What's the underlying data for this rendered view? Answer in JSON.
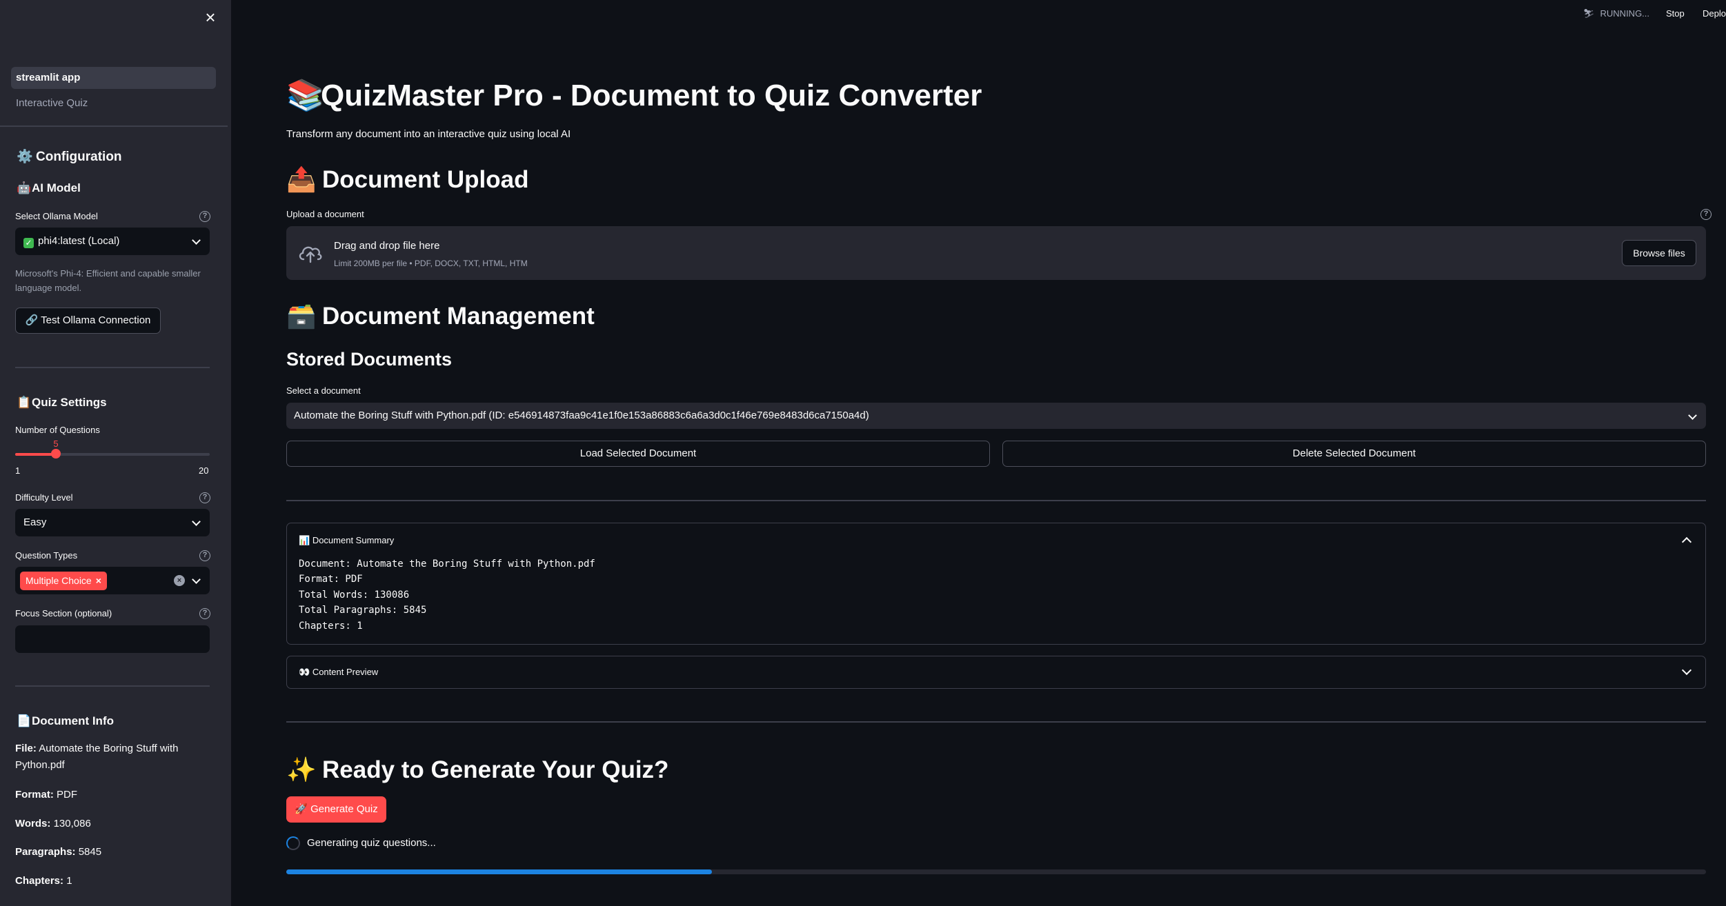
{
  "sidebar": {
    "close_icon": "×",
    "nav": [
      {
        "label": "streamlit app",
        "active": true
      },
      {
        "label": "Interactive Quiz",
        "active": false
      }
    ],
    "configuration": {
      "icon": "⚙️",
      "title": "Configuration"
    },
    "ai_model": {
      "icon": "🤖",
      "title": "AI Model",
      "select_label": "Select Ollama Model",
      "select_value": "phi4:latest (Local)",
      "caption": "Microsoft's Phi-4: Efficient and capable smaller language model.",
      "test_button": "🔗 Test Ollama Connection"
    },
    "quiz_settings": {
      "icon": "📋",
      "title": "Quiz Settings",
      "num_questions_label": "Number of Questions",
      "num_questions_value": "5",
      "num_questions_min": "1",
      "num_questions_max": "20",
      "slider_fraction": 0.2105,
      "difficulty_label": "Difficulty Level",
      "difficulty_value": "Easy",
      "question_types_label": "Question Types",
      "question_types_selected": [
        "Multiple Choice"
      ],
      "focus_label": "Focus Section (optional)",
      "focus_value": ""
    },
    "document_info": {
      "icon": "📄",
      "title": "Document Info",
      "file_label": "File:",
      "file_value": "Automate the Boring Stuff with Python.pdf",
      "format_label": "Format:",
      "format_value": "PDF",
      "words_label": "Words:",
      "words_value": "130,086",
      "paragraphs_label": "Paragraphs:",
      "paragraphs_value": "5845",
      "chapters_label": "Chapters:",
      "chapters_value": "1"
    }
  },
  "header": {
    "running": "RUNNING...",
    "stop": "Stop",
    "deploy": "Deploy"
  },
  "main": {
    "title_emoji": "📚",
    "title": "QuizMaster Pro - Document to Quiz Converter",
    "subtitle": "Transform any document into an interactive quiz using local AI",
    "upload": {
      "emoji": "📤",
      "heading": "Document Upload",
      "label": "Upload a document",
      "drag_text": "Drag and drop file here",
      "limit_text": "Limit 200MB per file • PDF, DOCX, TXT, HTML, HTM",
      "browse_button": "Browse files"
    },
    "management": {
      "emoji": "🗃️",
      "heading": "Document Management",
      "subheading": "Stored Documents",
      "select_label": "Select a document",
      "select_value": "Automate the Boring Stuff with Python.pdf (ID: e546914873faa9c41e1f0e153a86883c6a6a3d0c1f46e769e8483d6ca7150a4d)",
      "load_button": "Load Selected Document",
      "delete_button": "Delete Selected Document"
    },
    "summary": {
      "icon": "📊",
      "title": "Document Summary",
      "lines": [
        "Document: Automate the Boring Stuff with Python.pdf",
        "Format: PDF",
        "Total Words: 130086",
        "Total Paragraphs: 5845",
        "Chapters: 1"
      ]
    },
    "preview": {
      "icon": "👀",
      "title": "Content Preview"
    },
    "generate": {
      "emoji": "✨",
      "heading": "Ready to Generate Your Quiz?",
      "button": "🚀 Generate Quiz",
      "status": "Generating quiz questions...",
      "progress": 0.3
    }
  },
  "colors": {
    "accent": "#ff4b4b",
    "progress": "#1c83e1",
    "background": "#0e1117",
    "sidebar": "#262730"
  }
}
